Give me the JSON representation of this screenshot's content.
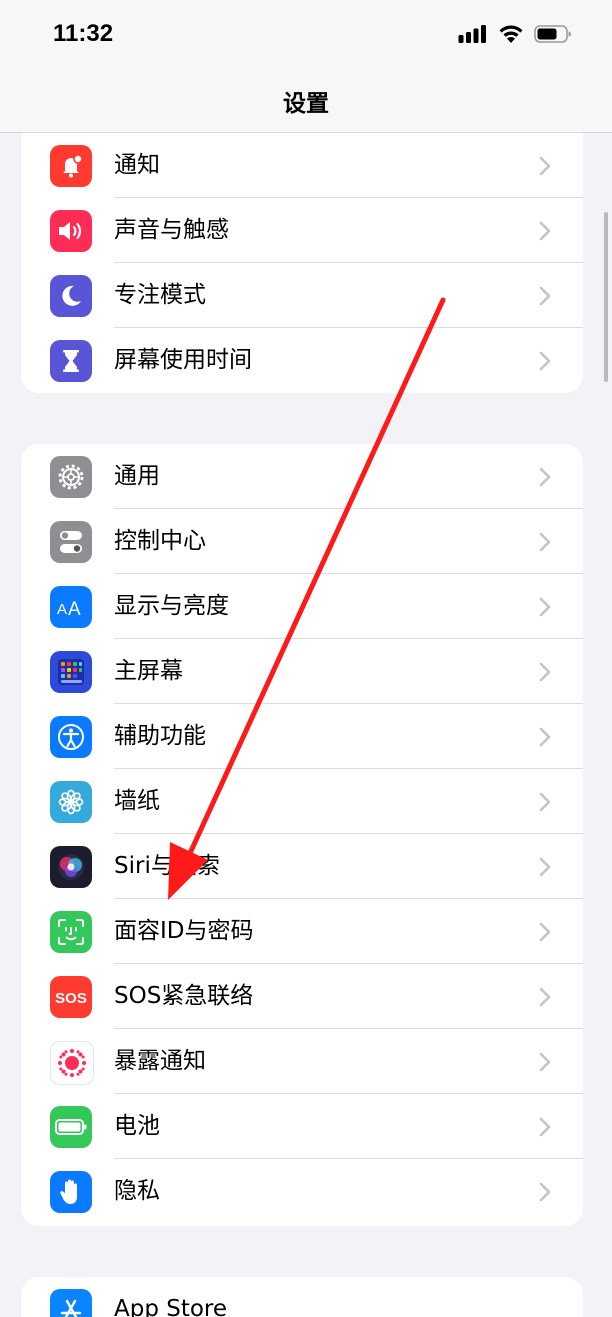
{
  "status_bar": {
    "time": "11:32",
    "icons": [
      "cellular-signal-icon",
      "wifi-icon",
      "battery-icon"
    ]
  },
  "nav": {
    "title": "设置"
  },
  "groups": [
    {
      "items": [
        {
          "label": "通知",
          "icon": "notifications-icon",
          "color": "#ff3b30"
        },
        {
          "label": "声音与触感",
          "icon": "sounds-icon",
          "color": "#ff2d55"
        },
        {
          "label": "专注模式",
          "icon": "focus-moon-icon",
          "color": "#5856d6"
        },
        {
          "label": "屏幕使用时间",
          "icon": "screen-time-hourglass-icon",
          "color": "#5856d6"
        }
      ]
    },
    {
      "items": [
        {
          "label": "通用",
          "icon": "general-gear-icon",
          "color": "#8e8e93"
        },
        {
          "label": "控制中心",
          "icon": "control-center-icon",
          "color": "#8e8e93"
        },
        {
          "label": "显示与亮度",
          "icon": "display-brightness-icon",
          "color": "#0a7aff"
        },
        {
          "label": "主屏幕",
          "icon": "home-screen-icon",
          "color": "#2c4bd8"
        },
        {
          "label": "辅助功能",
          "icon": "accessibility-icon",
          "color": "#0a7aff"
        },
        {
          "label": "墙纸",
          "icon": "wallpaper-icon",
          "color": "#34aadc"
        },
        {
          "label": "Siri与搜索",
          "icon": "siri-icon",
          "color": "#1c1c2e"
        },
        {
          "label": "面容ID与密码",
          "icon": "face-id-icon",
          "color": "#34c759"
        },
        {
          "label": "SOS紧急联络",
          "icon": "sos-icon",
          "color": "#ff3b30"
        },
        {
          "label": "暴露通知",
          "icon": "exposure-notification-icon",
          "color": "#ffffff"
        },
        {
          "label": "电池",
          "icon": "battery-settings-icon",
          "color": "#34c759"
        },
        {
          "label": "隐私",
          "icon": "privacy-hand-icon",
          "color": "#0a7aff"
        }
      ]
    },
    {
      "items": [
        {
          "label": "App Store",
          "icon": "app-store-icon",
          "color": "#0a84ff"
        }
      ]
    }
  ],
  "annotation": {
    "color": "#ff1a1a"
  }
}
